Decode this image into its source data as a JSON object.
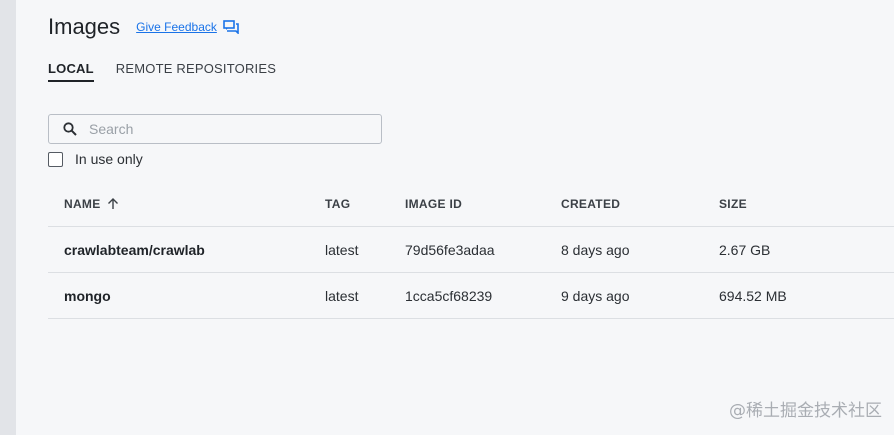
{
  "page": {
    "title": "Images",
    "feedback_label": "Give Feedback"
  },
  "tabs": [
    {
      "label": "LOCAL",
      "active": true
    },
    {
      "label": "REMOTE REPOSITORIES",
      "active": false
    }
  ],
  "search": {
    "placeholder": "Search",
    "value": ""
  },
  "filter": {
    "in_use_label": "In use only",
    "checked": false
  },
  "table": {
    "columns": {
      "name": "NAME",
      "tag": "TAG",
      "image_id": "IMAGE ID",
      "created": "CREATED",
      "size": "SIZE"
    },
    "sort": {
      "column": "name",
      "direction": "ascending"
    },
    "rows": [
      {
        "name": "crawlabteam/crawlab",
        "tag": "latest",
        "image_id": "79d56fe3adaa",
        "created": "8 days ago",
        "size": "2.67 GB"
      },
      {
        "name": "mongo",
        "tag": "latest",
        "image_id": "1cca5cf68239",
        "created": "9 days ago",
        "size": "694.52 MB"
      }
    ]
  },
  "watermark": "@稀土掘金技术社区",
  "icons": {
    "feedback": "chat-bubble-icon",
    "search": "search-icon",
    "sort": "arrow-up-icon"
  },
  "colors": {
    "link": "#1a73e8",
    "text": "#1f2328",
    "background": "#f6f7f9"
  }
}
